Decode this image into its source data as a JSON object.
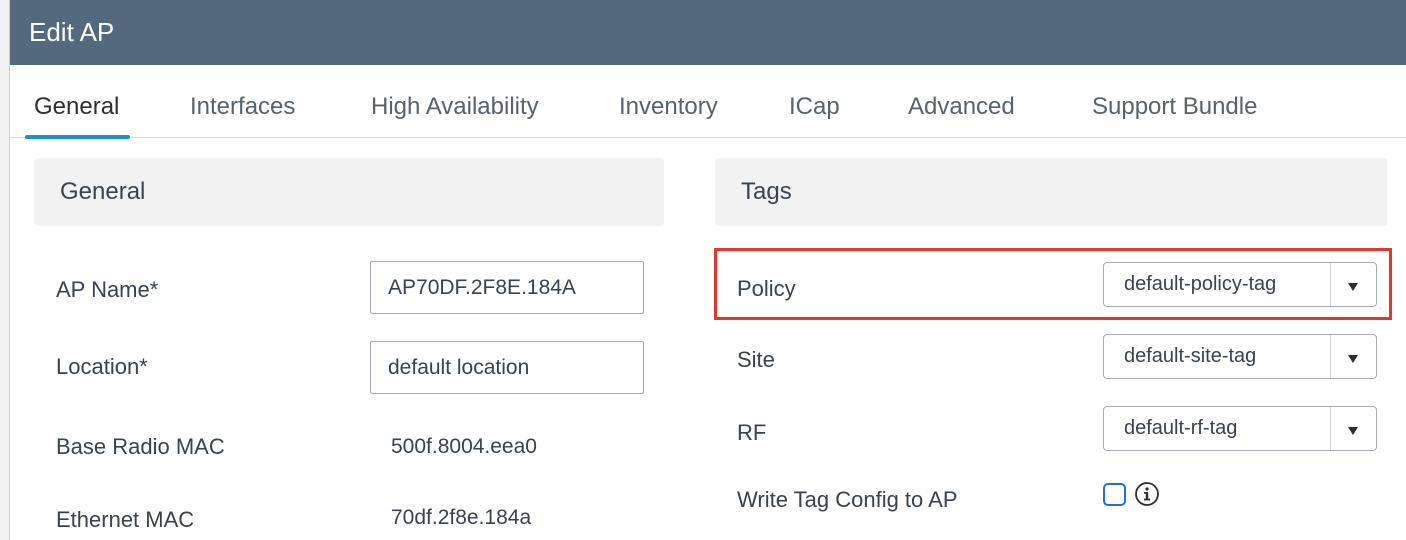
{
  "window": {
    "title": "Edit AP"
  },
  "tabs": [
    {
      "label": "General",
      "active": true
    },
    {
      "label": "Interfaces"
    },
    {
      "label": "High Availability"
    },
    {
      "label": "Inventory"
    },
    {
      "label": "ICap"
    },
    {
      "label": "Advanced"
    },
    {
      "label": "Support Bundle"
    }
  ],
  "general": {
    "header": "General",
    "ap_name": {
      "label": "AP Name*",
      "value": "AP70DF.2F8E.184A"
    },
    "location": {
      "label": "Location*",
      "value": "default location"
    },
    "base_radio_mac": {
      "label": "Base Radio MAC",
      "value": "500f.8004.eea0"
    },
    "ethernet_mac": {
      "label": "Ethernet MAC",
      "value": "70df.2f8e.184a"
    }
  },
  "tags": {
    "header": "Tags",
    "policy": {
      "label": "Policy",
      "value": "default-policy-tag"
    },
    "site": {
      "label": "Site",
      "value": "default-site-tag"
    },
    "rf": {
      "label": "RF",
      "value": "default-rf-tag"
    },
    "write_tag_config": {
      "label": "Write Tag Config to AP",
      "checked": false
    }
  },
  "colors": {
    "titlebar": "#536a7e",
    "active_tab_underline": "#1f8fcc",
    "highlight": "#e0382f",
    "checkbox": "#1f6fd6"
  },
  "icons": {
    "select_caret": "caret-down-icon",
    "info": "info-icon"
  }
}
